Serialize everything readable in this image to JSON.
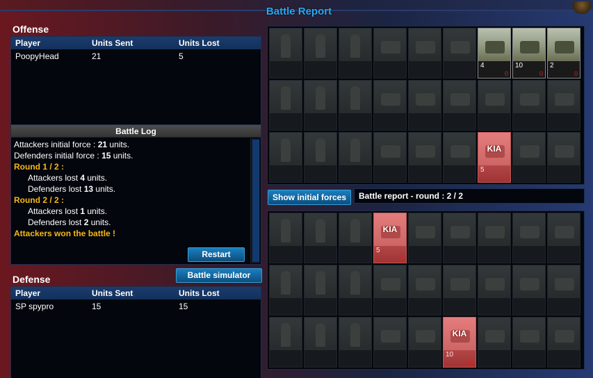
{
  "window": {
    "title": "Battle Report"
  },
  "offense": {
    "title": "Offense",
    "headers": [
      "Player",
      "Units Sent",
      "Units Lost"
    ],
    "rows": [
      {
        "player": "PoopyHead",
        "sent": "21",
        "lost": "5"
      }
    ]
  },
  "defense": {
    "title": "Defense",
    "headers": [
      "Player",
      "Units Sent",
      "Units Lost"
    ],
    "rows": [
      {
        "player": "SP spypro",
        "sent": "15",
        "lost": "15"
      }
    ]
  },
  "battle_log": {
    "title": "Battle Log",
    "lines": [
      {
        "text": "Attackers initial force : ",
        "bold": "21",
        "tail": " units.",
        "style": "plain"
      },
      {
        "text": "Defenders initial force : ",
        "bold": "15",
        "tail": " units.",
        "style": "plain"
      },
      {
        "text": "Round 1 / 2 :",
        "style": "gold"
      },
      {
        "text": "Attackers lost ",
        "bold": "4",
        "tail": " units.",
        "style": "indent"
      },
      {
        "text": "Defenders lost ",
        "bold": "13",
        "tail": " units.",
        "style": "indent"
      },
      {
        "text": "Round 2 / 2 :",
        "style": "gold"
      },
      {
        "text": "Attackers lost ",
        "bold": "1",
        "tail": " units.",
        "style": "indent"
      },
      {
        "text": "Defenders lost ",
        "bold": "2",
        "tail": " units.",
        "style": "indent"
      },
      {
        "text": "Attackers won the battle !",
        "style": "gold"
      }
    ]
  },
  "buttons": {
    "restart": "Restart",
    "battle_simulator": "Battle simulator",
    "show_initial_forces": "Show initial forces"
  },
  "report_label": "Battle report - round : 2 / 2",
  "kia_label": "KIA",
  "attacker_grid": [
    {
      "type": "inf"
    },
    {
      "type": "inf"
    },
    {
      "type": "inf"
    },
    {
      "type": "veh"
    },
    {
      "type": "veh"
    },
    {
      "type": "veh"
    },
    {
      "type": "veh",
      "state": "active",
      "count": "4",
      "lost": "0"
    },
    {
      "type": "veh",
      "state": "active",
      "count": "10",
      "lost": "0"
    },
    {
      "type": "veh",
      "state": "active",
      "count": "2",
      "lost": "0"
    },
    {
      "type": "inf"
    },
    {
      "type": "inf"
    },
    {
      "type": "inf"
    },
    {
      "type": "veh"
    },
    {
      "type": "veh"
    },
    {
      "type": "veh"
    },
    {
      "type": "veh"
    },
    {
      "type": "veh"
    },
    {
      "type": "veh"
    },
    {
      "type": "inf"
    },
    {
      "type": "inf"
    },
    {
      "type": "inf"
    },
    {
      "type": "veh"
    },
    {
      "type": "veh"
    },
    {
      "type": "veh"
    },
    {
      "type": "veh",
      "state": "kia",
      "count": "5",
      "lost": "5"
    },
    {
      "type": "veh"
    },
    {
      "type": "veh"
    }
  ],
  "defender_grid": [
    {
      "type": "inf"
    },
    {
      "type": "inf"
    },
    {
      "type": "inf"
    },
    {
      "type": "veh",
      "state": "kia",
      "count": "5",
      "lost": "5"
    },
    {
      "type": "veh"
    },
    {
      "type": "veh"
    },
    {
      "type": "veh"
    },
    {
      "type": "veh"
    },
    {
      "type": "veh"
    },
    {
      "type": "inf"
    },
    {
      "type": "inf"
    },
    {
      "type": "inf"
    },
    {
      "type": "veh"
    },
    {
      "type": "veh"
    },
    {
      "type": "veh"
    },
    {
      "type": "veh"
    },
    {
      "type": "veh"
    },
    {
      "type": "veh"
    },
    {
      "type": "inf"
    },
    {
      "type": "inf"
    },
    {
      "type": "inf"
    },
    {
      "type": "veh"
    },
    {
      "type": "veh"
    },
    {
      "type": "veh",
      "state": "kia",
      "count": "10",
      "lost": "10"
    },
    {
      "type": "veh"
    },
    {
      "type": "veh"
    },
    {
      "type": "veh"
    }
  ]
}
